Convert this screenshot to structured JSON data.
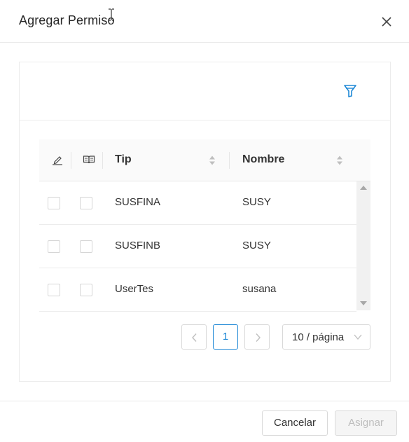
{
  "dialog": {
    "title": "Agregar Permiso",
    "close_icon": "close-icon",
    "filter_icon": "filter-icon"
  },
  "table": {
    "header_icons": [
      "edit-icon",
      "book-icon"
    ],
    "columns": [
      "Tip",
      "Nombre"
    ],
    "rows": [
      {
        "tip": "SUSFINA",
        "nombre": "SUSY"
      },
      {
        "tip": "SUSFINB",
        "nombre": "SUSY"
      },
      {
        "tip": "UserTes",
        "nombre": "susana"
      }
    ]
  },
  "pagination": {
    "current_page": "1",
    "page_size": "10 / página"
  },
  "footer": {
    "cancel_label": "Cancelar",
    "assign_label": "Asignar"
  },
  "colors": {
    "accent": "#1e88d6",
    "border": "#d9d9d9",
    "disabled_text": "#bdbdbd"
  }
}
